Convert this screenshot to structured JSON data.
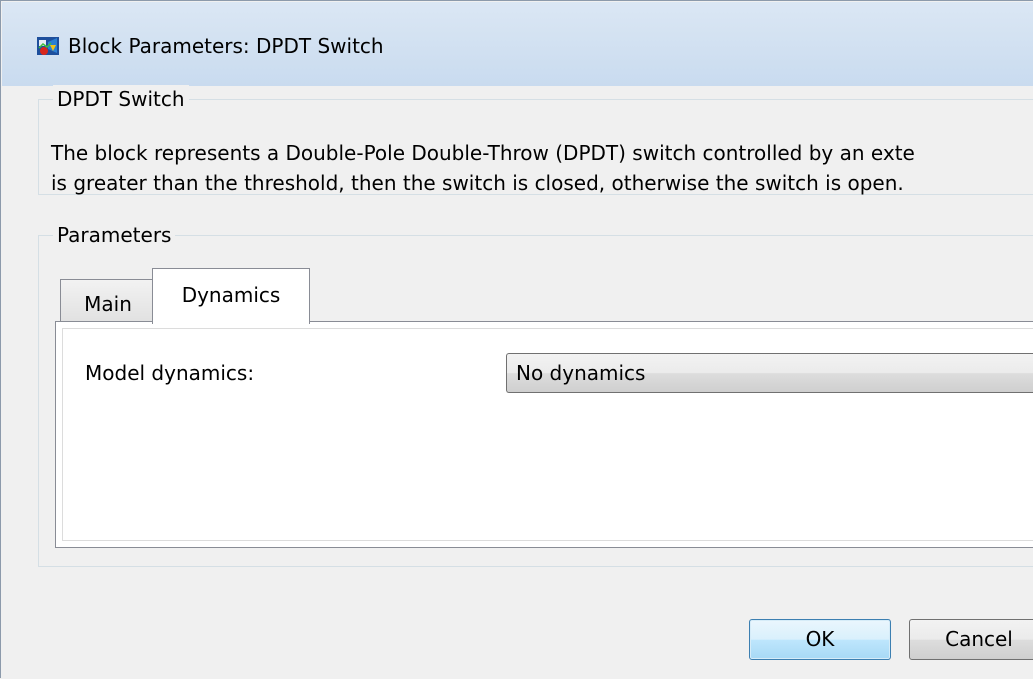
{
  "window": {
    "title": "Block Parameters: DPDT Switch",
    "icon": "simulink-block-icon"
  },
  "description": {
    "group_label": "DPDT Switch",
    "lines": [
      "The block represents a Double-Pole Double-Throw (DPDT) switch controlled by an exte",
      "is greater than the threshold, then the switch is closed, otherwise the switch is open."
    ]
  },
  "parameters": {
    "group_label": "Parameters",
    "tabs": [
      {
        "label": "Main",
        "active": false
      },
      {
        "label": "Dynamics",
        "active": true
      }
    ],
    "fields": {
      "model_dynamics": {
        "label": "Model dynamics:",
        "value": "No dynamics"
      }
    }
  },
  "buttons": {
    "ok": "OK",
    "cancel": "Cancel"
  },
  "colors": {
    "titlebar": "#c9dbef",
    "ok_border": "#3c7fb1"
  }
}
